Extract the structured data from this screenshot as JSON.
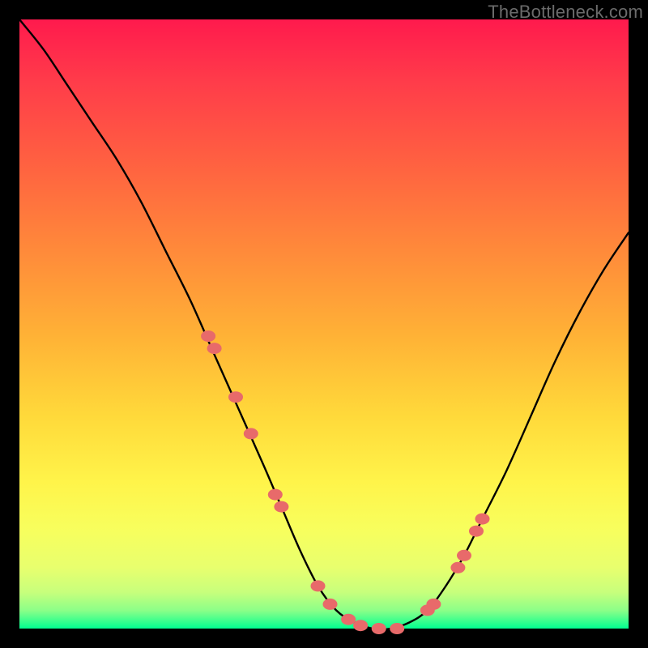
{
  "watermark": "TheBottleneck.com",
  "chart_data": {
    "type": "line",
    "title": "",
    "xlabel": "",
    "ylabel": "",
    "xlim": [
      0,
      100
    ],
    "ylim": [
      0,
      100
    ],
    "series": [
      {
        "name": "bottleneck-curve",
        "x": [
          0,
          4,
          8,
          12,
          16,
          20,
          24,
          28,
          32,
          36,
          40,
          43,
          46,
          49,
          52,
          55,
          58,
          61,
          64,
          67,
          70,
          73,
          76,
          80,
          84,
          88,
          92,
          96,
          100
        ],
        "values": [
          100,
          95,
          89,
          83,
          77,
          70,
          62,
          54,
          45,
          36,
          27,
          20,
          13,
          7,
          3,
          1,
          0,
          0,
          1,
          3,
          7,
          12,
          18,
          26,
          35,
          44,
          52,
          59,
          65
        ]
      },
      {
        "name": "highlight-markers",
        "x": [
          31,
          32,
          35.5,
          38,
          42,
          43,
          49,
          51,
          54,
          56,
          59,
          62,
          67,
          68,
          72,
          73,
          75,
          76
        ],
        "values": [
          48,
          46,
          38,
          32,
          22,
          20,
          7,
          4,
          1.5,
          0.5,
          0,
          0,
          3,
          4,
          10,
          12,
          16,
          18
        ]
      }
    ],
    "background_gradient": {
      "top": "#ff1a4d",
      "mid_upper": "#ff8a3a",
      "mid_lower": "#fff44a",
      "bottom": "#00ff90"
    },
    "marker_color": "#e86a6a",
    "curve_color": "#000000"
  }
}
